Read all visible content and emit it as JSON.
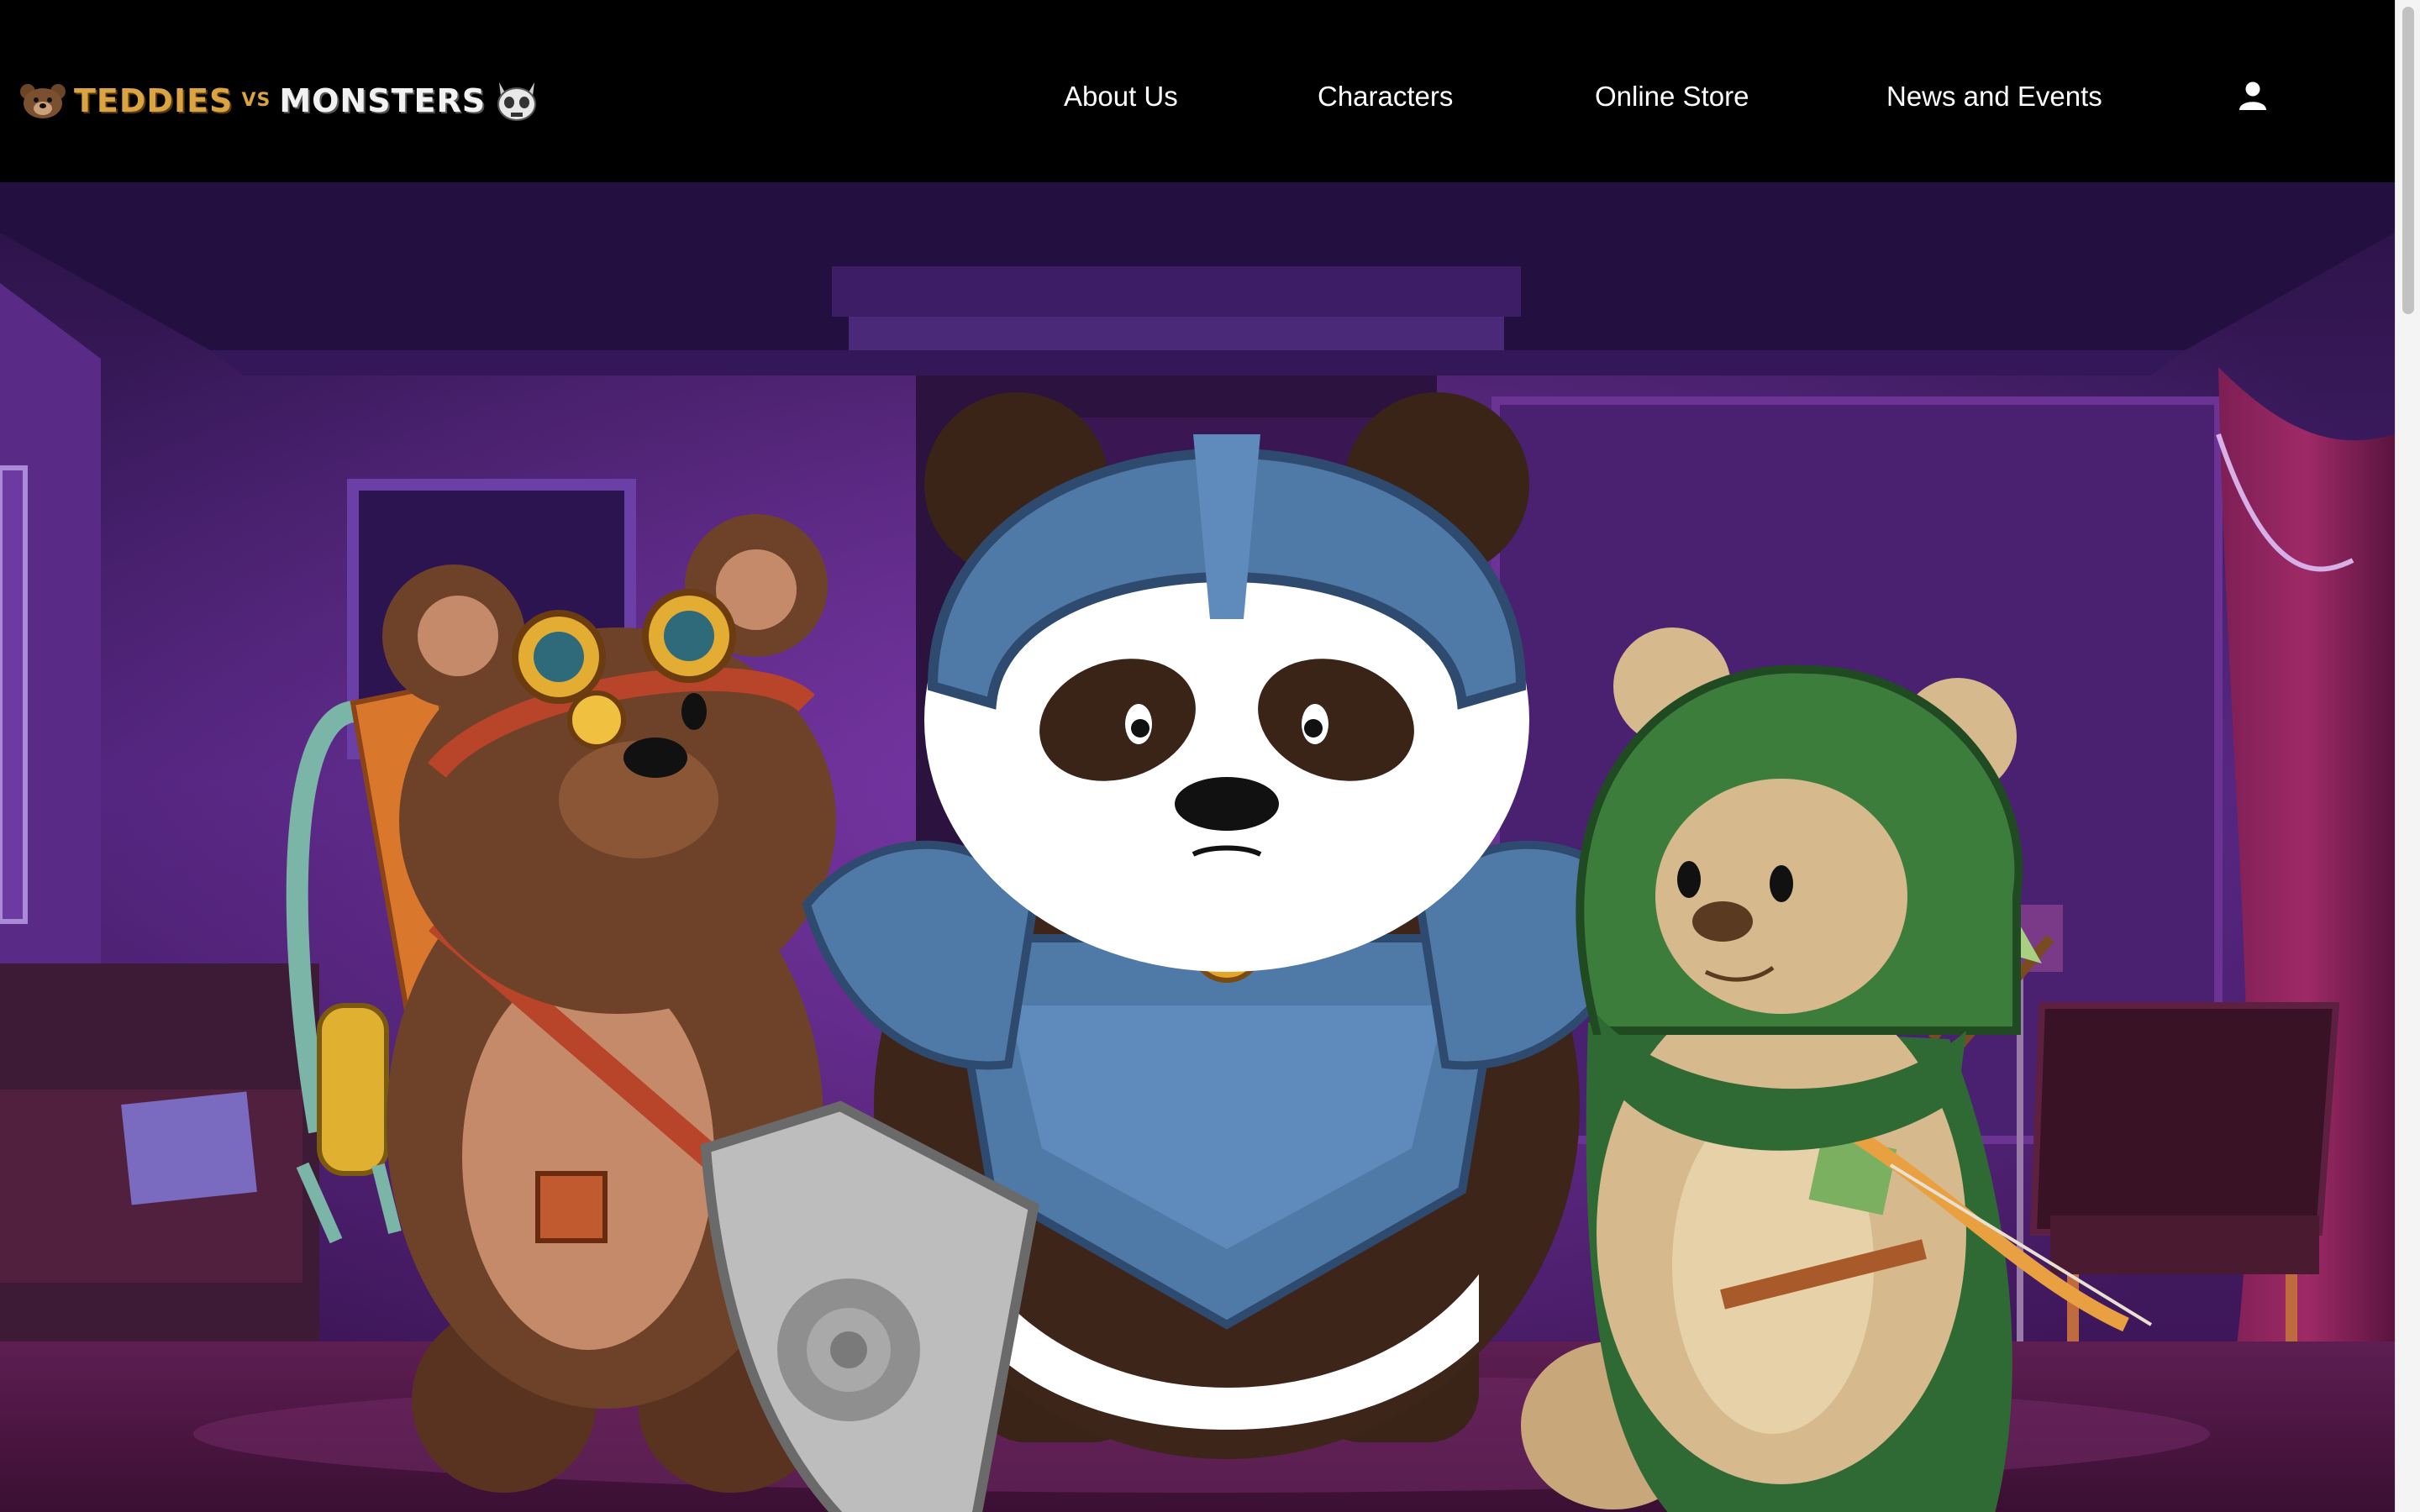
{
  "brand": {
    "logo_text_left": "TEDDIES",
    "logo_text_vs": "VS",
    "logo_text_right": "MONSTERS",
    "logo_icons": [
      "bear-head-icon",
      "monster-skull-icon"
    ]
  },
  "nav": {
    "items": [
      {
        "label": "About Us"
      },
      {
        "label": "Characters"
      },
      {
        "label": "Online Store"
      },
      {
        "label": "News and Events"
      }
    ],
    "account_icon": "user-icon"
  },
  "hero": {
    "image_description_icons": [
      "steampunk-bear",
      "armored-panda",
      "archer-bear"
    ]
  },
  "colors": {
    "header_bg": "#000000",
    "nav_text": "#ffffff",
    "brand_gold": "#d9a441",
    "room_purple": "#4a2374"
  }
}
